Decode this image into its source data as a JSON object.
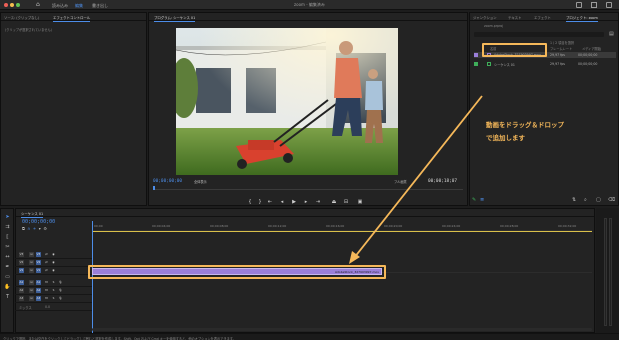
{
  "window": {
    "title": "zoom - 編集済み"
  },
  "workspaces": {
    "home_icon": "home-icon",
    "tabs": [
      "読み込み",
      "編集",
      "書き出し"
    ],
    "active": "編集"
  },
  "left_panel": {
    "tabs": [
      "ソース: (クリップなし)",
      "エフェクトコントロール"
    ],
    "message": "(クリップが選択されていません)"
  },
  "program_monitor": {
    "title": "プログラム: シーケンス 01",
    "timecode_current": "00;00;00;00",
    "fit": "全体表示",
    "quality": "フル画質",
    "timecode_duration": "00;00;18;07"
  },
  "project_panel": {
    "tabs": [
      "ジャンクション",
      "テキスト",
      "エフェクト",
      "プロジェクト: zoom"
    ],
    "file": "zoom.prproj",
    "item_count": "1 / 2 項目を選択",
    "columns": [
      "名前",
      "フレームレート",
      "メディア開始"
    ],
    "rows": [
      {
        "name": "AdobeStock_327903997.mov",
        "fps": "29,97 fps",
        "start": "00;00;00;00",
        "color": "#9a7fd9",
        "selected": true
      },
      {
        "name": "シーケンス 01",
        "fps": "29,97 fps",
        "start": "00;00;00;00",
        "color": "#3fae5a",
        "selected": false
      }
    ]
  },
  "timeline": {
    "tab": "シーケンス 01",
    "timecode": "00;00;00;00",
    "ruler": [
      "00;00",
      "00;00;04;00",
      "00;00;08;00",
      "00;00;12;00",
      "00;00;16;00",
      "00;00;20;00",
      "00;00;24;00",
      "00;00;28;00",
      "00;00;32;00"
    ],
    "video_tracks": [
      "V3",
      "V2",
      "V1"
    ],
    "audio_tracks": [
      "A1",
      "A2",
      "A3"
    ],
    "master_label": "ミックス",
    "master_value": "0.0",
    "clip_label": "AdobeStock_327903997.mov"
  },
  "annotation": {
    "line1": "動画をドラッグ＆ドロップ",
    "line2": "で追加します"
  },
  "status_bar": {
    "text": "クリックで選択、または空白をクリックしてドラッグして囲むと選択を作成します。Shift、Opt および Cmd キーを使用すると、他のオプションを表示できます。"
  },
  "colors": {
    "accent": "#4d8de8",
    "highlight": "#f5b85a",
    "clip": "#9a7fd9"
  }
}
